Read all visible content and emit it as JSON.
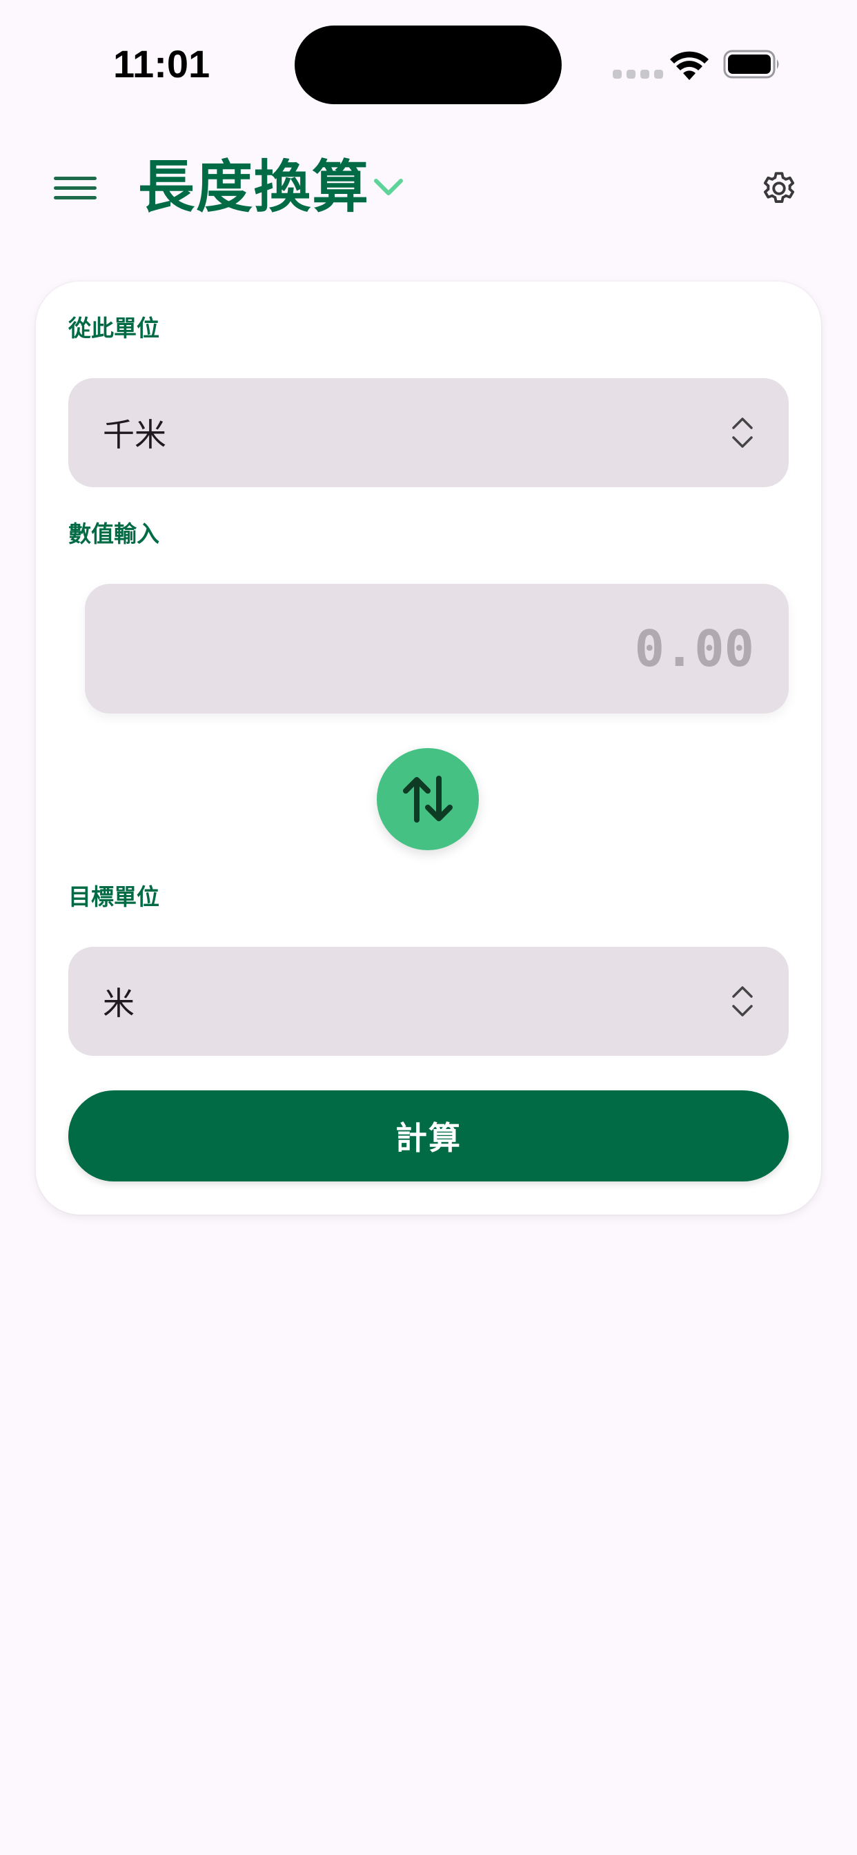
{
  "status_bar": {
    "time": "11:01"
  },
  "app_bar": {
    "title": "長度換算",
    "menu_icon": "hamburger-menu-icon",
    "dropdown_icon": "chevron-down-icon",
    "settings_icon": "gear-icon"
  },
  "converter": {
    "from_label": "從此單位",
    "from_unit": "千米",
    "value_label": "數值輸入",
    "value_placeholder": "0.00",
    "swap_icon": "swap-vertical-icon",
    "to_label": "目標單位",
    "to_unit": "米",
    "calculate_label": "計算"
  },
  "colors": {
    "primary": "#006b45",
    "accent": "#45c184",
    "background": "#fcf8fd",
    "field": "#e6e0e6"
  }
}
